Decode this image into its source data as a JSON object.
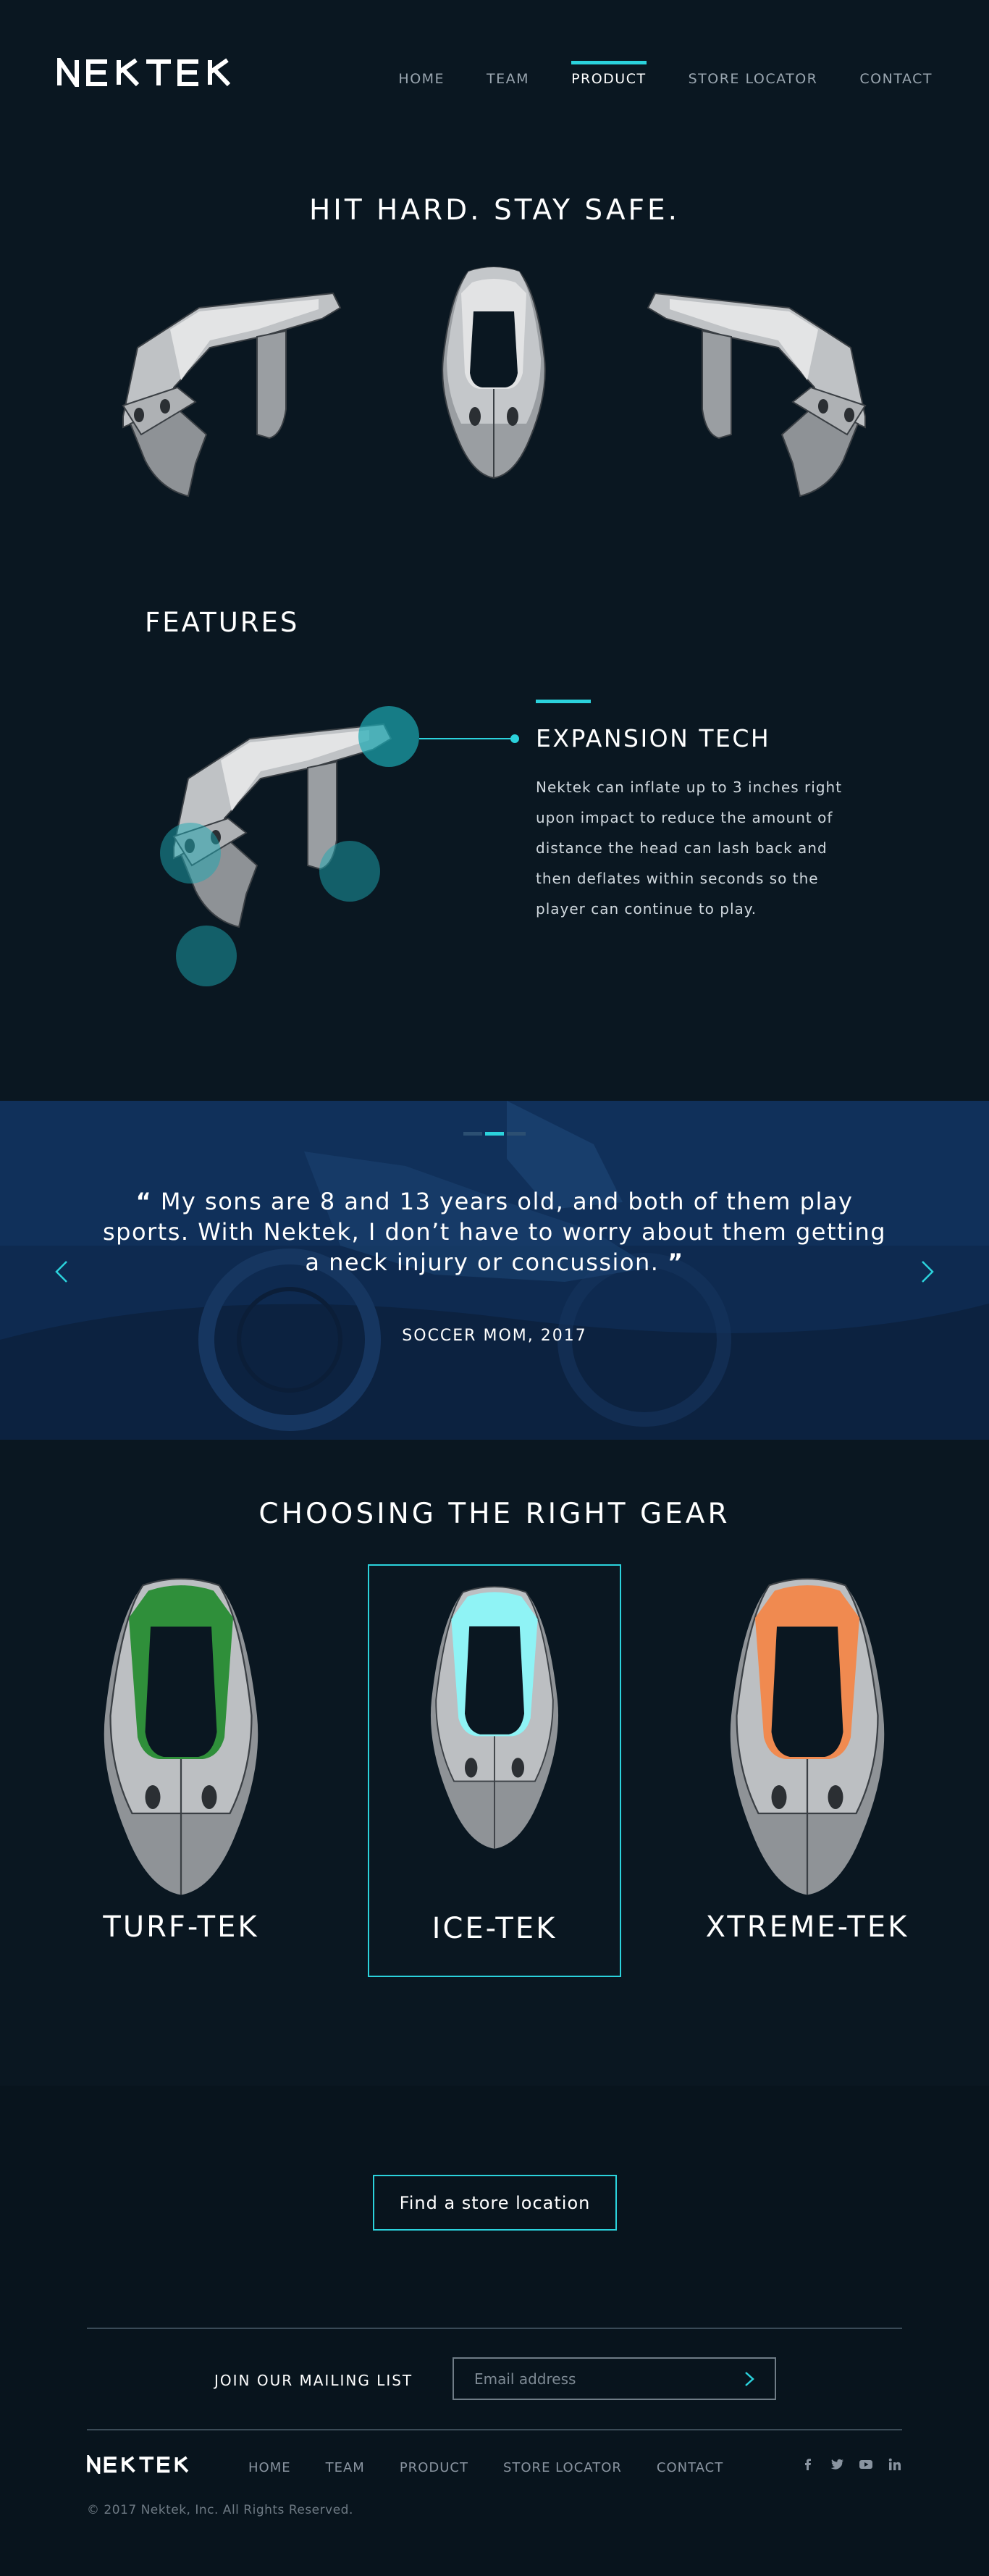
{
  "brand": {
    "logo_text": "NEKTEK",
    "accent_color": "#2bd2dc"
  },
  "nav": {
    "items": [
      {
        "label": "HOME"
      },
      {
        "label": "TEAM"
      },
      {
        "label": "PRODUCT",
        "active": true
      },
      {
        "label": "STORE LOCATOR"
      },
      {
        "label": "CONTACT"
      }
    ]
  },
  "hero": {
    "title": "HIT HARD. STAY SAFE."
  },
  "features": {
    "section_title": "FEATURES",
    "active_feature": {
      "title": "EXPANSION TECH",
      "description": "Nektek can inflate up to 3 inches right upon impact to reduce the amount of distance the head can lash back and then deflates within seconds so the player can continue to play."
    }
  },
  "testimonial": {
    "quote": "My sons are 8 and 13 years old, and both of them play sports. With Nektek, I don’t have to worry about them getting a neck injury or concussion.",
    "open_mark": "“",
    "close_mark": "”",
    "attribution": "SOCCER MOM, 2017",
    "slide_count": 3,
    "active_slide": 1,
    "prev_icon": "chevron-left-icon",
    "next_icon": "chevron-right-icon"
  },
  "gear": {
    "title": "CHOOSING THE RIGHT GEAR",
    "products": [
      {
        "name": "TURF-TEK",
        "color": "#2f8f3a",
        "selected": false
      },
      {
        "name": "ICE-TEK",
        "color": "#8ff3f5",
        "selected": true
      },
      {
        "name": "XTREME-TEK",
        "color": "#f08a50",
        "selected": false
      }
    ]
  },
  "cta": {
    "label": "Find a store location"
  },
  "footer": {
    "mailing_label": "JOIN OUR MAILING LIST",
    "email_placeholder": "Email address",
    "nav": [
      "HOME",
      "TEAM",
      "PRODUCT",
      "STORE LOCATOR",
      "CONTACT"
    ],
    "social": [
      "facebook-icon",
      "twitter-icon",
      "youtube-icon",
      "linkedin-icon"
    ],
    "copyright": "© 2017 Nektek, Inc. All Rights Reserved."
  }
}
